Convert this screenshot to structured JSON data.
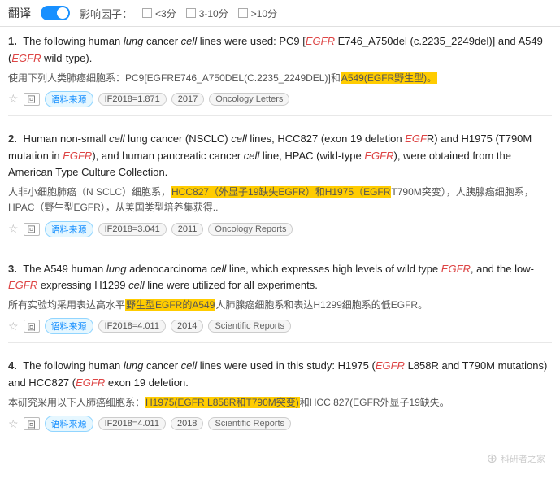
{
  "topbar": {
    "translate_label": "翻译",
    "toggle_state": "on",
    "filter_label": "影响因子：",
    "filters": [
      {
        "id": "lt3",
        "label": "<3分"
      },
      {
        "id": "3to10",
        "label": "3-10分"
      },
      {
        "id": "gt10",
        "label": ">10分"
      }
    ]
  },
  "results": [
    {
      "number": "1.",
      "en_parts": [
        {
          "text": "The following human ",
          "type": "plain"
        },
        {
          "text": "lung",
          "type": "italic"
        },
        {
          "text": " cancer ",
          "type": "plain"
        },
        {
          "text": "cell",
          "type": "italic"
        },
        {
          "text": " lines were used: PC9 [",
          "type": "plain"
        },
        {
          "text": "EGFR",
          "type": "gene"
        },
        {
          "text": " E746_A750del (c.2235_2249del)] and A549 (",
          "type": "plain"
        },
        {
          "text": "EGFR",
          "type": "gene"
        },
        {
          "text": " wild-type).",
          "type": "plain"
        }
      ],
      "cn_parts": [
        {
          "text": "使用下列人类肺癌细胞系：PC9[EGFRE746_A750DEL(C.2235_2249DEL)]和",
          "type": "plain"
        },
        {
          "text": "A549(EGFR野生型)。",
          "type": "highlight"
        }
      ],
      "meta": {
        "source_label": "语料来源",
        "if_label": "IF2018=1.871",
        "year": "2017",
        "journal": "Oncology Letters"
      }
    },
    {
      "number": "2.",
      "en_parts": [
        {
          "text": "Human non-small ",
          "type": "plain"
        },
        {
          "text": "cell",
          "type": "italic"
        },
        {
          "text": " lung cancer (NSCLC) ",
          "type": "plain"
        },
        {
          "text": "cell",
          "type": "italic"
        },
        {
          "text": " lines, HCC827 (exon 19 deletion ",
          "type": "plain"
        },
        {
          "text": "EGF",
          "type": "gene"
        },
        {
          "text": "R) and H1975 (T790M mutation in ",
          "type": "plain"
        },
        {
          "text": "EGFR",
          "type": "gene"
        },
        {
          "text": "), and human pancreatic cancer ",
          "type": "plain"
        },
        {
          "text": "cell",
          "type": "italic"
        },
        {
          "text": " line, HPAC (wild-type ",
          "type": "plain"
        },
        {
          "text": "EGFR",
          "type": "gene"
        },
        {
          "text": "), were obtained from the American Type Culture Collection.",
          "type": "plain"
        }
      ],
      "cn_parts": [
        {
          "text": "人非小细胞肺癌（N SCLC）细胞系，",
          "type": "plain"
        },
        {
          "text": "HCC827（外显子19缺失EGFR）和H1975（EGFR",
          "type": "highlight"
        },
        {
          "text": "T790M突变），人胰腺癌细胞系，HPAC（野生型EGFR），从美国类型培养集获得..",
          "type": "plain"
        }
      ],
      "meta": {
        "source_label": "语料来源",
        "if_label": "IF2018=3.041",
        "year": "2011",
        "journal": "Oncology Reports"
      }
    },
    {
      "number": "3.",
      "en_parts": [
        {
          "text": "The A549 human ",
          "type": "plain"
        },
        {
          "text": "lung",
          "type": "italic"
        },
        {
          "text": " adenocarcinoma ",
          "type": "plain"
        },
        {
          "text": "cell",
          "type": "italic"
        },
        {
          "text": " line, which expresses high levels of wild type ",
          "type": "plain"
        },
        {
          "text": "EGFR",
          "type": "gene"
        },
        {
          "text": ", and the low-",
          "type": "plain"
        },
        {
          "text": "EGFR",
          "type": "gene"
        },
        {
          "text": " expressing H1299 ",
          "type": "plain"
        },
        {
          "text": "cell",
          "type": "italic"
        },
        {
          "text": " line were utilized for all experiments.",
          "type": "plain"
        }
      ],
      "cn_parts": [
        {
          "text": "所有实验均采用表达高水平",
          "type": "plain"
        },
        {
          "text": "野生型EGFR的A549",
          "type": "highlight"
        },
        {
          "text": "人肺腺癌细胞系和表达H1299细胞系的低EGFR。",
          "type": "plain"
        }
      ],
      "meta": {
        "source_label": "语料来源",
        "if_label": "IF2018=4.011",
        "year": "2014",
        "journal": "Scientific Reports"
      }
    },
    {
      "number": "4.",
      "en_parts": [
        {
          "text": "The following human ",
          "type": "plain"
        },
        {
          "text": "lung",
          "type": "italic"
        },
        {
          "text": " cancer ",
          "type": "plain"
        },
        {
          "text": "cell",
          "type": "italic"
        },
        {
          "text": " lines were used in this study: H1975 (",
          "type": "plain"
        },
        {
          "text": "EGFR",
          "type": "gene"
        },
        {
          "text": " L858R and T790M mutations) and HCC827 (",
          "type": "plain"
        },
        {
          "text": "EGFR",
          "type": "gene"
        },
        {
          "text": " exon 19 deletion.",
          "type": "plain"
        }
      ],
      "cn_parts": [
        {
          "text": "本研究采用以下人肺癌细胞系：",
          "type": "plain"
        },
        {
          "text": "H1975(EGFR L858R和T790M突变)",
          "type": "highlight"
        },
        {
          "text": "和HCC 827(EGFR外显子19缺失。",
          "type": "plain"
        }
      ],
      "meta": {
        "source_label": "语料来源",
        "if_label": "IF2018=4.011",
        "year": "2018",
        "journal": "Scientific Reports"
      }
    }
  ],
  "watermark": {
    "icon": "⊕",
    "text": "科研者之家"
  }
}
